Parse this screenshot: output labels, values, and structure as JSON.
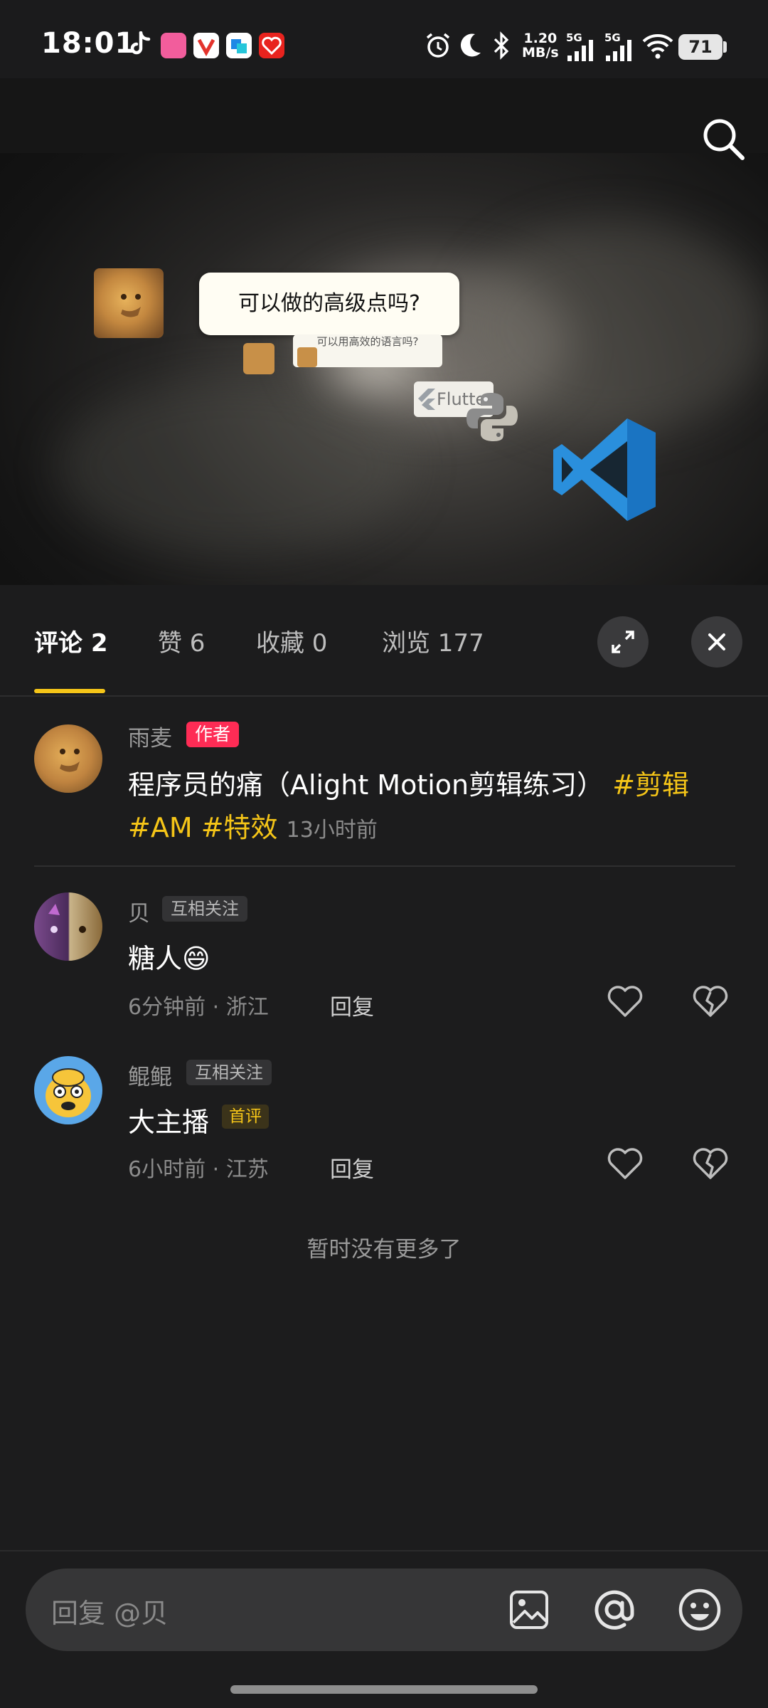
{
  "status_bar": {
    "time": "18:01",
    "net_speed_value": "1.20",
    "net_speed_unit": "MB/s",
    "sim1": "5G",
    "sim2": "5G",
    "battery": "71"
  },
  "video": {
    "bubble_text": "可以做的高级点吗?",
    "small_bubble_text": "可以用高效的语言吗?",
    "flutter_label": "Flutter"
  },
  "tabs": [
    {
      "label": "评论 2"
    },
    {
      "label": "赞 6"
    },
    {
      "label": "收藏 0"
    },
    {
      "label": "浏览 177"
    }
  ],
  "post": {
    "author": "雨麦",
    "author_badge": "作者",
    "text": "程序员的痛（Alight Motion剪辑练习）",
    "tag1": "#剪辑",
    "tag2": "#AM",
    "tag3": "#特效",
    "time": "13小时前"
  },
  "comments": [
    {
      "user": "贝",
      "badge": "互相关注",
      "text": "糖人",
      "emoji": "😄",
      "meta": "6分钟前 · 浙江",
      "reply_label": "回复"
    },
    {
      "user": "鲲鲲",
      "badge": "互相关注",
      "text": "大主播",
      "extra_badge": "首评",
      "meta": "6小时前 · 江苏",
      "reply_label": "回复"
    }
  ],
  "no_more": "暂时没有更多了",
  "input": {
    "placeholder": "回复 @贝"
  },
  "colors": {
    "background": "#1c1c1d",
    "accent_yellow": "#f5c518",
    "author_badge": "#fe2c55",
    "vscode_blue": "#2a8fdc"
  }
}
